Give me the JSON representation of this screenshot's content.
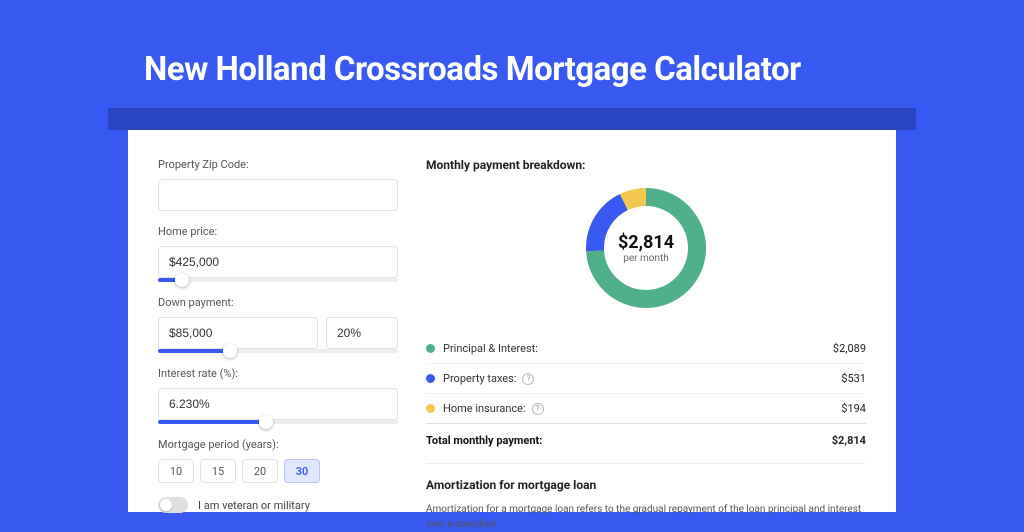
{
  "page": {
    "title": "New Holland Crossroads Mortgage Calculator"
  },
  "form": {
    "zip": {
      "label": "Property Zip Code:",
      "value": ""
    },
    "price": {
      "label": "Home price:",
      "value": "$425,000",
      "slider_pct": 10
    },
    "down": {
      "label": "Down payment:",
      "amount": "$85,000",
      "pct": "20%",
      "slider_pct": 30
    },
    "rate": {
      "label": "Interest rate (%):",
      "value": "6.230%",
      "slider_pct": 45
    },
    "period": {
      "label": "Mortgage period (years):",
      "options": [
        "10",
        "15",
        "20",
        "30"
      ],
      "selected": "30"
    },
    "veteran": {
      "label": "I am veteran or military",
      "on": false
    }
  },
  "breakdown": {
    "title": "Monthly payment breakdown:",
    "center_amount": "$2,814",
    "center_sub": "per month",
    "items": [
      {
        "label": "Principal & Interest:",
        "value": "$2,089",
        "color": "#4fb08a",
        "info": false
      },
      {
        "label": "Property taxes:",
        "value": "$531",
        "color": "#3859f2",
        "info": true
      },
      {
        "label": "Home insurance:",
        "value": "$194",
        "color": "#f2c94c",
        "info": true
      }
    ],
    "total_label": "Total monthly payment:",
    "total_value": "$2,814"
  },
  "donut_arcs": [
    {
      "color": "#4fb08a",
      "dasharray": "237 320",
      "dashoffset": "0"
    },
    {
      "color": "#3859f2",
      "dasharray": "60 320",
      "dashoffset": "-237"
    },
    {
      "color": "#f2c94c",
      "dasharray": "23 320",
      "dashoffset": "-297"
    }
  ],
  "amort": {
    "title": "Amortization for mortgage loan",
    "text": "Amortization for a mortgage loan refers to the gradual repayment of the loan principal and interest over a specified"
  }
}
